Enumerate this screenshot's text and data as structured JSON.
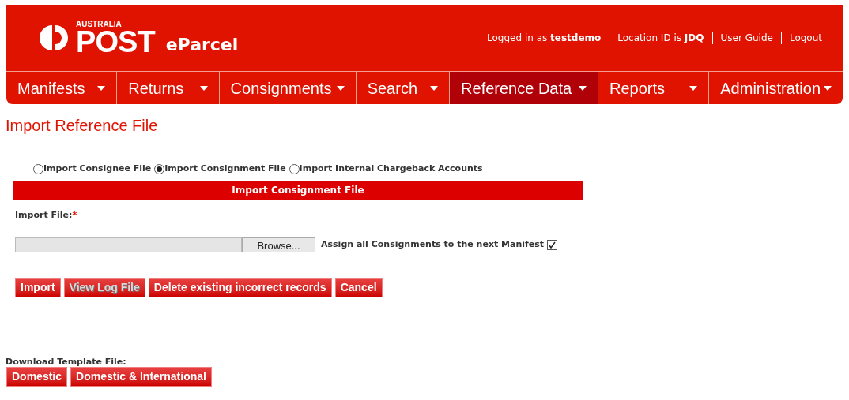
{
  "header": {
    "logo_small": "AUSTRALIA",
    "logo_big": "POST",
    "product": "eParcel",
    "info": [
      "Logged in as **testdemo**",
      "Location ID is **JDQ**"
    ],
    "links": [
      "User Guide",
      "Logout"
    ]
  },
  "nav": [
    {
      "label": "Manifests",
      "selected": false
    },
    {
      "label": "Returns",
      "selected": false
    },
    {
      "label": "Consignments",
      "selected": false
    },
    {
      "label": "Search",
      "selected": false
    },
    {
      "label": "Reference Data",
      "selected": true
    },
    {
      "label": "Reports",
      "selected": false
    },
    {
      "label": "Administration",
      "selected": false
    }
  ],
  "page_title": "Import Reference File",
  "import_types": [
    {
      "label": "Import Consignee File",
      "selected": false
    },
    {
      "label": "Import Consignment File",
      "selected": true
    },
    {
      "label": "Import Internal Chargeback Accounts",
      "selected": false
    }
  ],
  "section_title": "Import Consignment File",
  "import_file": {
    "label": "Import File:",
    "required_mark": "*",
    "browse": "Browse...",
    "assign_label": "Assign all Consignments to the next Manifest",
    "assign_checked": true
  },
  "actions": [
    {
      "label": "Import",
      "disabled": false
    },
    {
      "label": "View Log File",
      "disabled": true
    },
    {
      "label": "Delete existing incorrect records",
      "disabled": false
    },
    {
      "label": "Cancel",
      "disabled": false
    }
  ],
  "download": {
    "label": "Download Template File:",
    "buttons": [
      "Domestic",
      "Domestic & International"
    ]
  }
}
